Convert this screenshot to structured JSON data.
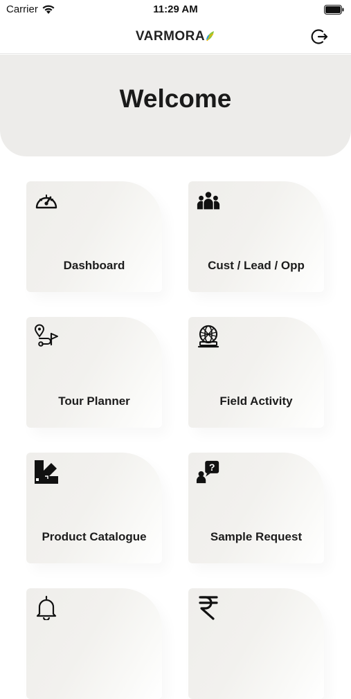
{
  "status_bar": {
    "carrier": "Carrier",
    "time": "11:29 AM"
  },
  "header": {
    "brand": "VARMORA",
    "brand_leaf_colors": [
      "#8cc63f",
      "#f4b400",
      "#2a9fd6"
    ]
  },
  "welcome": {
    "title": "Welcome"
  },
  "menu": {
    "tiles": [
      {
        "label": "Dashboard",
        "icon": "speedometer-icon"
      },
      {
        "label": "Cust / Lead / Opp",
        "icon": "people-group-icon"
      },
      {
        "label": "Tour Planner",
        "icon": "route-location-flag-icon"
      },
      {
        "label": "Field Activity",
        "icon": "globe-dome-icon"
      },
      {
        "label": "Product Catalogue",
        "icon": "swatch-palette-icon"
      },
      {
        "label": "Sample Request",
        "icon": "person-question-icon"
      },
      {
        "label": "",
        "icon": "bell-icon"
      },
      {
        "label": "",
        "icon": "rupee-icon"
      }
    ]
  }
}
